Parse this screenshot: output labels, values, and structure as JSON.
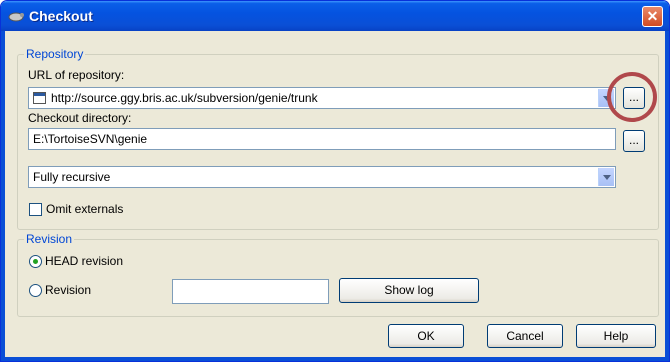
{
  "window": {
    "title": "Checkout",
    "close_glyph": "✕"
  },
  "repository": {
    "legend": "Repository",
    "url_label": "URL of repository:",
    "url_value": "http://source.ggy.bris.ac.uk/subversion/genie/trunk",
    "browse_label": "...",
    "dir_label": "Checkout directory:",
    "dir_value": "E:\\TortoiseSVN\\genie",
    "dir_browse_label": "...",
    "depth_value": "Fully recursive",
    "omit_externals_label": "Omit externals",
    "omit_externals_checked": false
  },
  "revision": {
    "legend": "Revision",
    "head_label": "HEAD revision",
    "revision_label": "Revision",
    "revision_value": "",
    "show_log_label": "Show log",
    "selected": "HEAD revision"
  },
  "buttons": {
    "ok": "OK",
    "cancel": "Cancel",
    "help": "Help"
  },
  "annotation": {
    "color": "#b0484b"
  }
}
